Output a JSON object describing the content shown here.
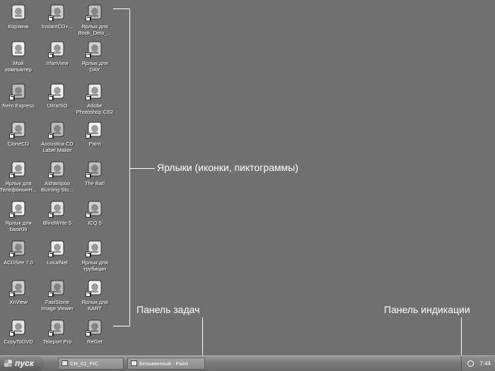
{
  "desktop": {
    "icons": [
      {
        "name": "recycle-bin",
        "label": "Корзина",
        "icon": "recycle-bin-icon"
      },
      {
        "name": "instantcd",
        "label": "InstantCD+...",
        "icon": "instantcd-icon"
      },
      {
        "name": "book-delo-shortcut",
        "label": "Ярлык для\nBook_Delo_...",
        "icon": "folder-icon"
      },
      {
        "name": "my-computer",
        "label": "Мой\nкомпьютер",
        "icon": "computer-icon"
      },
      {
        "name": "irfanview",
        "label": "IrfanView",
        "icon": "irfanview-icon"
      },
      {
        "name": "day-shortcut",
        "label": "Ярлык для\nDAY",
        "icon": "word-document-icon"
      },
      {
        "name": "nero-express",
        "label": "Nero Express",
        "icon": "nero-icon"
      },
      {
        "name": "ultraiso",
        "label": "UltraISO",
        "icon": "disc-icon"
      },
      {
        "name": "photoshop",
        "label": "Adobe\nPhotoshop CS2",
        "icon": "photoshop-icon"
      },
      {
        "name": "clonecd",
        "label": "CloneCD",
        "icon": "clonecd-icon"
      },
      {
        "name": "acoustica",
        "label": "Acoustica CD\nLabel Maker",
        "icon": "cd-label-icon"
      },
      {
        "name": "paint",
        "label": "Paint",
        "icon": "paint-icon"
      },
      {
        "name": "telefon-shortcut",
        "label": "Ярлык для\nТелефонынН...",
        "icon": "phonebook-icon"
      },
      {
        "name": "ashampoo",
        "label": "Ashampoo\nBurning Stu...",
        "icon": "ashampoo-icon"
      },
      {
        "name": "thebat",
        "label": "The Bat!",
        "icon": "bat-icon"
      },
      {
        "name": "base09-shortcut",
        "label": "Ярлык для\nbase09",
        "icon": "database-icon"
      },
      {
        "name": "blindwrite",
        "label": "BlindWrite 5",
        "icon": "blindwrite-icon"
      },
      {
        "name": "icq",
        "label": "ICQ 5",
        "icon": "icq-flower-icon"
      },
      {
        "name": "acdsee",
        "label": "ACDSee 7.0",
        "icon": "acdsee-icon"
      },
      {
        "name": "localnet",
        "label": "LocalNet",
        "icon": "localnet-icon"
      },
      {
        "name": "trubitsin-shortcut",
        "label": "Ярлык для\nтрубицин",
        "icon": "users-icon"
      },
      {
        "name": "xnview",
        "label": "XnView",
        "icon": "xnview-icon"
      },
      {
        "name": "faststone",
        "label": "FastStone\nImage Viewer",
        "icon": "eye-icon"
      },
      {
        "name": "kart-shortcut",
        "label": "Ярлык для\nKART",
        "icon": "document-icon"
      },
      {
        "name": "copytodvd",
        "label": "CopyToDVD",
        "icon": "copytodvd-icon"
      },
      {
        "name": "teleport-pro",
        "label": "Teleport Pro",
        "icon": "teleport-icon"
      },
      {
        "name": "reget",
        "label": "ReGet",
        "icon": "reget-icon"
      }
    ]
  },
  "callouts": {
    "shortcuts": "Ярлыки (иконки, пиктограммы)",
    "taskbar": "Панель задач",
    "tray": "Панель индикации"
  },
  "taskbar": {
    "start_label": "пуск",
    "tasks": [
      {
        "label": "CH_01_PIC",
        "icon": "folder-icon"
      },
      {
        "label": "Безымянный - Paint",
        "icon": "paint-icon"
      }
    ],
    "clock": "7:44"
  },
  "colors": {
    "desktop": "#707070",
    "text": "#ffffff"
  }
}
